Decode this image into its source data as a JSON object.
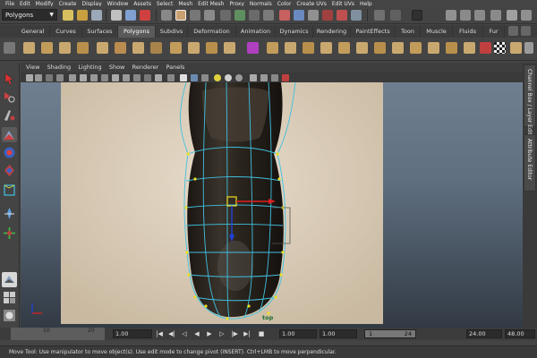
{
  "menubar": [
    "File",
    "Edit",
    "Modify",
    "Create",
    "Display",
    "Window",
    "Assets",
    "Select",
    "Mesh",
    "Edit Mesh",
    "Proxy",
    "Normals",
    "Color",
    "Create UVs",
    "Edit UVs",
    "Help"
  ],
  "status_line": {
    "mode": "Polygons"
  },
  "shelf": {
    "tabs": [
      "General",
      "Curves",
      "Surfaces",
      "Polygons",
      "Subdivs",
      "Deformation",
      "Animation",
      "Dynamics",
      "Rendering",
      "PaintEffects",
      "Toon",
      "Muscle",
      "Fluids",
      "Fur"
    ],
    "active_tab": "Polygons"
  },
  "panel": {
    "menu": [
      "View",
      "Shading",
      "Lighting",
      "Show",
      "Renderer",
      "Panels"
    ],
    "camera": "top"
  },
  "side_tabs": {
    "channel_box": "Channel Box / Layer Editor",
    "attribute_editor": "Attribute Editor"
  },
  "time_slider": {
    "tick_labels": [
      "10",
      "20"
    ],
    "start_time": "1.00",
    "current_frame": "1.00",
    "range_start": "1.00",
    "playback_start": "1",
    "playback_end_display": "24",
    "range_end": "24.00",
    "end_time": "48.00"
  },
  "help_line": "Move Tool: Use manipulator to move object(s). Use edit mode to change pivot (INSERT). Ctrl+LMB to move perpendicular.",
  "colors": {
    "ui_bg": "#444444",
    "active_tab": "#5a5a5a",
    "manip_x": "#e02020",
    "manip_y": "#2040e0",
    "selection": "#f0e020",
    "mesh_wire": "#40c0e0"
  }
}
